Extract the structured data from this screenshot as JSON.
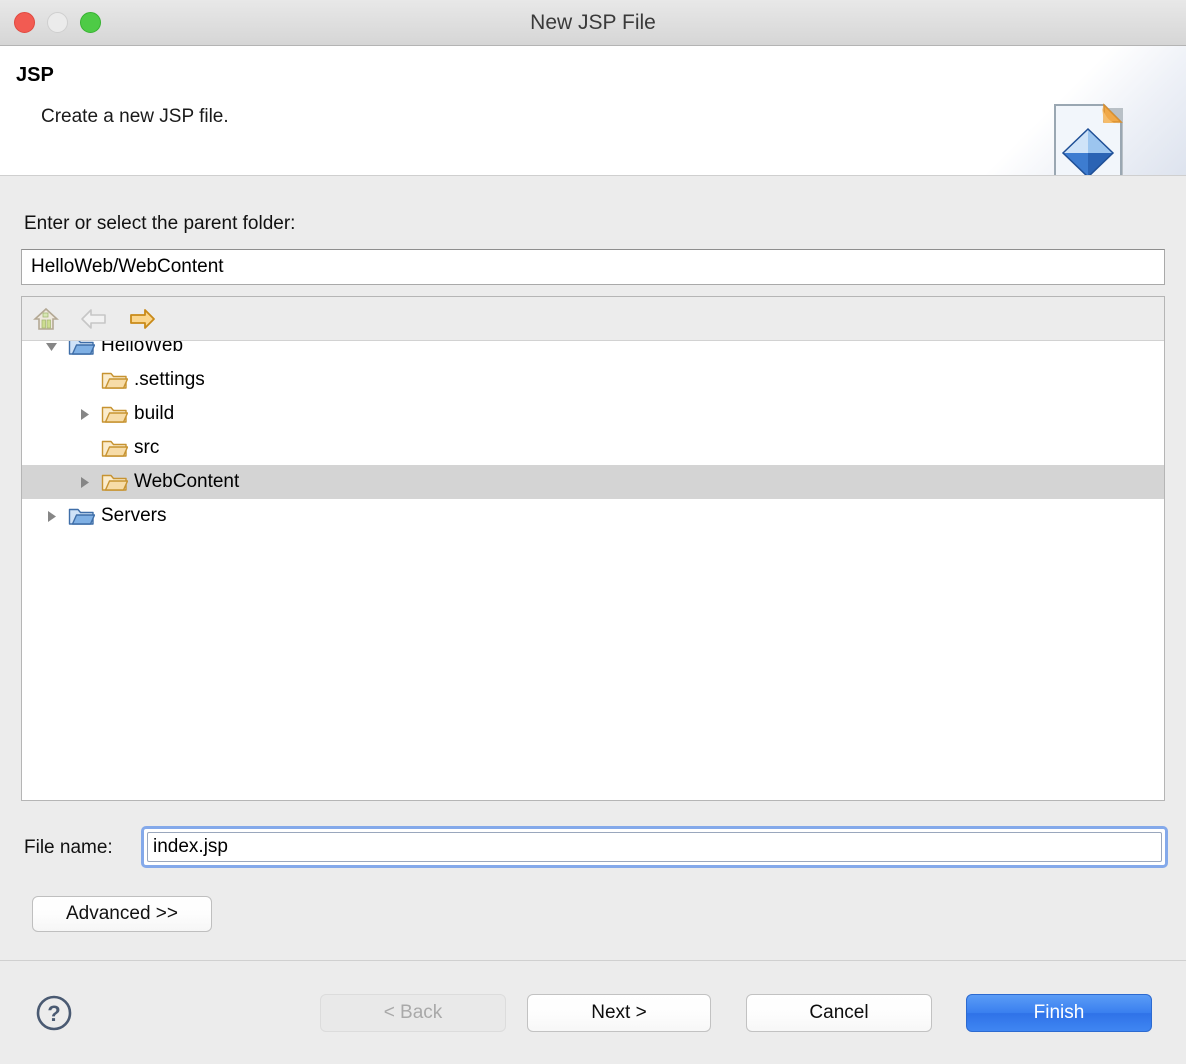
{
  "window": {
    "title": "New JSP File",
    "controls": {
      "close": "close-button",
      "minimize": "minimize-button",
      "zoom": "zoom-button"
    }
  },
  "header": {
    "title": "JSP",
    "description": "Create a new JSP file.",
    "icon": "jsp-file-icon"
  },
  "form": {
    "parent_folder_label": "Enter or select the parent folder:",
    "parent_folder_value": "HelloWeb/WebContent",
    "parent_folder_placeholder": "Enter or select the parent folder",
    "file_name_label": "File name:",
    "file_name_value": "index.jsp",
    "file_name_placeholder": "File name",
    "advanced_label": "Advanced >>"
  },
  "tree_toolbar": {
    "home": "home-icon",
    "back": "back-arrow-icon",
    "forward": "forward-arrow-icon"
  },
  "tree": {
    "items": [
      {
        "label": "HelloWeb",
        "indent": 0,
        "twisty": "expanded",
        "icon": "project-folder-icon",
        "selected": false,
        "clipped": true
      },
      {
        "label": ".settings",
        "indent": 1,
        "twisty": "none",
        "icon": "folder-icon",
        "selected": false
      },
      {
        "label": "build",
        "indent": 1,
        "twisty": "collapsed",
        "icon": "folder-icon",
        "selected": false
      },
      {
        "label": "src",
        "indent": 1,
        "twisty": "none",
        "icon": "folder-icon",
        "selected": false
      },
      {
        "label": "WebContent",
        "indent": 1,
        "twisty": "collapsed",
        "icon": "folder-icon",
        "selected": true
      },
      {
        "label": "Servers",
        "indent": 0,
        "twisty": "collapsed",
        "icon": "project-folder-icon",
        "selected": false
      }
    ]
  },
  "footer": {
    "help": "help-icon",
    "back_label": "< Back",
    "next_label": "Next >",
    "cancel_label": "Cancel",
    "finish_label": "Finish"
  },
  "colors": {
    "accent": "#397fef",
    "selection": "#d4d4d4",
    "focus_ring": "#84a9ea",
    "window_bg": "#ececec",
    "folder": "#f5d9a0",
    "project_folder": "#8fb8e8"
  }
}
